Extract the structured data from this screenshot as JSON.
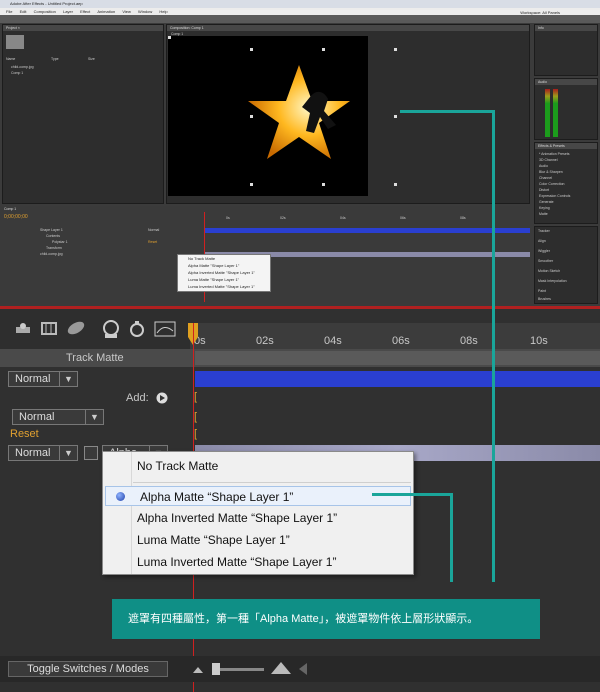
{
  "app": {
    "title": "Adobe After Effects - Untitled Project.aep",
    "menu": [
      "File",
      "Edit",
      "Composition",
      "Layer",
      "Effect",
      "Animation",
      "View",
      "Window",
      "Help"
    ],
    "workspace_label": "Workspace: All Panels",
    "search_help_placeholder": "Search Help"
  },
  "mini": {
    "project_tab": "Project ×",
    "comp_tab": "Composition: Comp 1",
    "comp_label": "Comp 1",
    "project_items": [
      "child-comp.jpg",
      "Comp 1"
    ],
    "project_cols": [
      "Name",
      "Type",
      "Size"
    ],
    "info_tab": "Info",
    "audio_tab": "Audio",
    "effects_tab": "Effects & Presets",
    "effects_items": [
      "* Animation Presets",
      "3D Channel",
      "Audio",
      "Blur & Sharpen",
      "Channel",
      "Color Correction",
      "Distort",
      "Expression Controls",
      "Generate",
      "Keying",
      "Matte",
      "Noise & Grain"
    ],
    "side_tabs": [
      "Tracker",
      "Align",
      "Wiggler",
      "Smoother",
      "Motion Sketch",
      "Mask Interpolation",
      "Paint",
      "Brushes"
    ],
    "timecode": "0;00;00;00",
    "timeline_tab": "Comp 1",
    "layers": [
      "Shape Layer 1",
      "Contents",
      "Polystar 1",
      "Transform",
      "child-comp.jpg"
    ],
    "mode": "Normal",
    "reset": "Reset",
    "menu_items": [
      "No Track Matte",
      "Alpha Matte \"Shape Layer 1\"",
      "Alpha Inverted Matte \"Shape Layer 1\"",
      "Luma Matte \"Shape Layer 1\"",
      "Luma Inverted Matte \"Shape Layer 1\""
    ],
    "ticks": [
      "0s",
      "02s",
      "04s",
      "06s",
      "08s",
      "10s"
    ]
  },
  "zoom": {
    "track_matte_header": "Track Matte",
    "ticks": [
      "0s",
      "02s",
      "04s",
      "06s",
      "08s",
      "10s"
    ],
    "mode1": "Normal",
    "add_label": "Add:",
    "mode2": "Normal",
    "reset": "Reset",
    "mode3": "Normal",
    "matte_value": "Alpha",
    "toggle_label": "Toggle Switches / Modes",
    "menu": {
      "items": [
        "No Track Matte",
        "Alpha Matte “Shape Layer 1”",
        "Alpha Inverted Matte “Shape Layer 1”",
        "Luma Matte “Shape Layer 1”",
        "Luma Inverted Matte “Shape Layer 1”"
      ],
      "selected_index": 1
    }
  },
  "caption": "遮罩有四種屬性，第一種「Alpha Matte」，被遮罩物件依上層形狀顯示。",
  "colors": {
    "accent_teal": "#0f8f86",
    "divider_red": "#b02020",
    "layer_blue": "#2a3fd0",
    "reset_orange": "#e0a030"
  }
}
